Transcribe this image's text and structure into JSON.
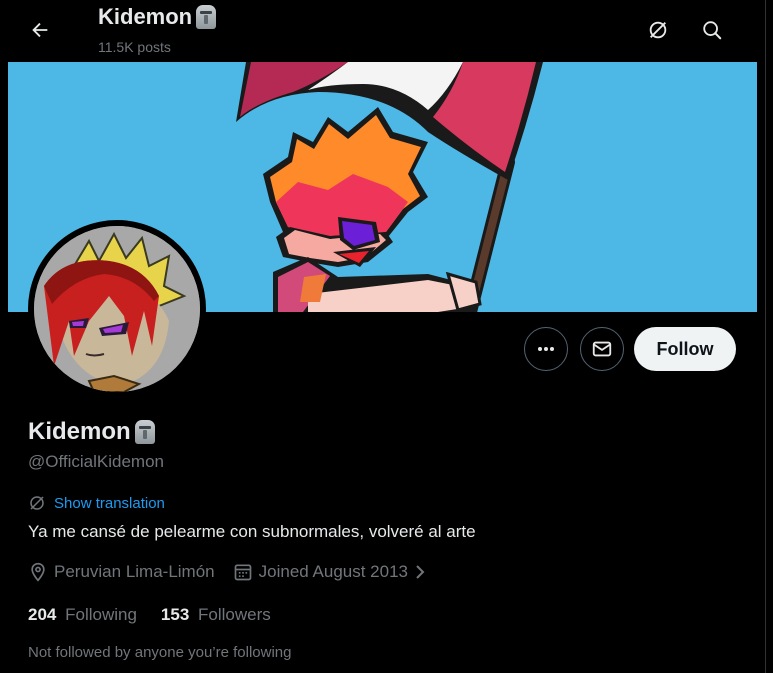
{
  "header": {
    "back_label": "Back",
    "title": "Kidemon",
    "posts_count": "11.5K posts"
  },
  "profile": {
    "display_name": "Kidemon",
    "handle": "@OfficialKidemon",
    "show_translation": "Show translation",
    "bio": "Ya me cansé de pelearme con subnormales, volveré al arte",
    "location": "Peruvian Lima-Limón",
    "joined": "Joined August 2013",
    "following_count": "204",
    "following_label": "Following",
    "followers_count": "153",
    "followers_label": "Followers",
    "not_followed_text": "Not followed by anyone you’re following"
  },
  "actions": {
    "follow_label": "Follow"
  },
  "colors": {
    "background": "#000000",
    "banner_sky": "#4db8e5",
    "link_blue": "#1d9bf0",
    "muted_text": "#71767b",
    "follow_button_bg": "#eff3f4"
  },
  "icons": {
    "back": "arrow-left-icon",
    "translate_header": "translate-icon",
    "search": "search-icon",
    "more": "more-icon",
    "message": "envelope-icon",
    "location": "location-pin-icon",
    "calendar": "calendar-icon",
    "emoji": "moai-emoji-icon"
  }
}
